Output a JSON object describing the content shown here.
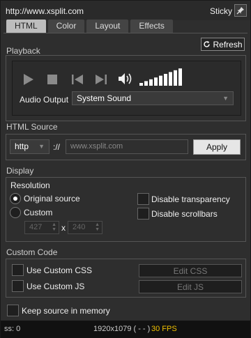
{
  "window": {
    "title_url": "http://www.xsplit.com",
    "sticky_label": "Sticky"
  },
  "tabs": [
    {
      "label": "HTML",
      "active": true
    },
    {
      "label": "Color",
      "active": false
    },
    {
      "label": "Layout",
      "active": false
    },
    {
      "label": "Effects",
      "active": false
    }
  ],
  "playback": {
    "section_label": "Playback",
    "refresh_label": "Refresh",
    "audio_output_label": "Audio Output",
    "audio_output_value": "System Sound",
    "volume_level_bars": 9,
    "volume_total_bars": 9
  },
  "html_source": {
    "section_label": "HTML Source",
    "protocol_value": "http",
    "separator": "://",
    "url_value": "www.xsplit.com",
    "apply_label": "Apply"
  },
  "display": {
    "section_label": "Display",
    "resolution_label": "Resolution",
    "original_source_label": "Original source",
    "original_source_checked": true,
    "custom_label": "Custom",
    "custom_checked": false,
    "width_value": "427",
    "height_value": "240",
    "x_label": "x",
    "disable_transparency_label": "Disable transparency",
    "disable_scrollbars_label": "Disable scrollbars"
  },
  "custom_code": {
    "section_label": "Custom Code",
    "use_css_label": "Use Custom CSS",
    "use_js_label": "Use Custom JS",
    "edit_css_label": "Edit CSS",
    "edit_js_label": "Edit JS"
  },
  "keep_source_label": "Keep source in memory",
  "status": {
    "ss": "ss: 0",
    "resolution": "1920x1079 ( - - )",
    "fps": "30 FPS"
  },
  "colors": {
    "background": "#2e2e2e",
    "active_tab": "#bdbdbd",
    "fps_accent": "#f0c000"
  }
}
